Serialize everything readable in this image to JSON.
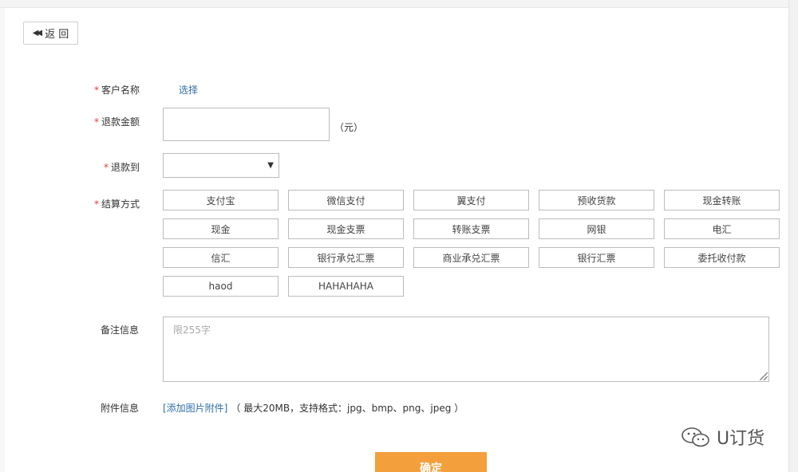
{
  "back_button": {
    "label": "返 回"
  },
  "form": {
    "customer": {
      "label": "客户名称",
      "action": "选择"
    },
    "amount": {
      "label": "退款金额",
      "value": "",
      "unit": "（元）"
    },
    "refund_to": {
      "label": "退款到",
      "selected": ""
    },
    "settlement": {
      "label": "结算方式",
      "options": [
        "支付宝",
        "微信支付",
        "翼支付",
        "预收货款",
        "现金转账",
        "现金",
        "现金支票",
        "转账支票",
        "网银",
        "电汇",
        "信汇",
        "银行承兑汇票",
        "商业承兑汇票",
        "银行汇票",
        "委托收付款",
        "haod",
        "HAHAHAHA"
      ]
    },
    "remark": {
      "label": "备注信息",
      "placeholder": "限255字"
    },
    "attachment": {
      "label": "附件信息",
      "link": "[添加图片附件]",
      "hint": "（ 最大20MB，支持格式：jpg、bmp、png、jpeg ）"
    },
    "required_mark": "*"
  },
  "confirm": {
    "label": "确定"
  },
  "watermark": {
    "text": "U订货"
  },
  "colors": {
    "accent": "#f3a03c",
    "link": "#2f6fa8",
    "required": "#e4393c"
  }
}
